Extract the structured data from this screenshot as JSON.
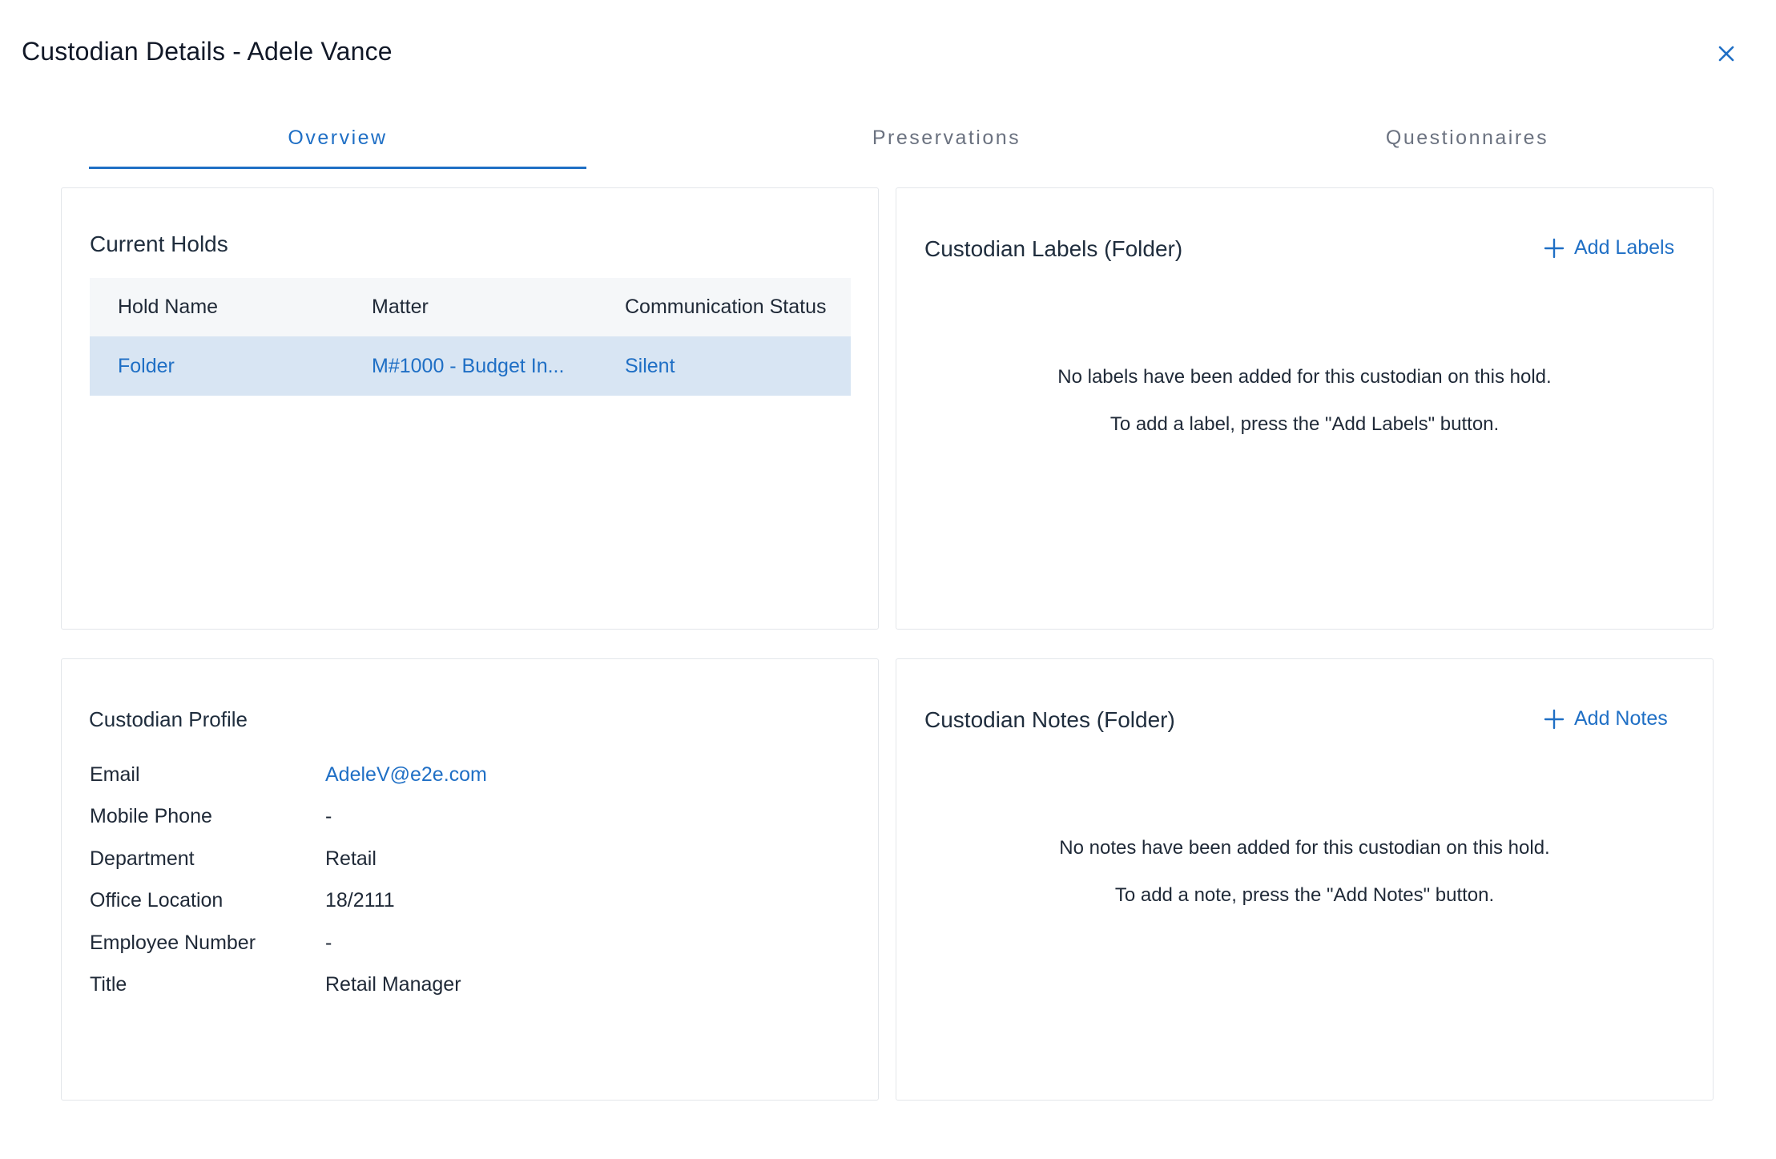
{
  "dialog": {
    "title": "Custodian Details - Adele Vance",
    "close_icon": "close-icon"
  },
  "tabs": [
    {
      "label": "Overview",
      "active": true
    },
    {
      "label": "Preservations",
      "active": false
    },
    {
      "label": "Questionnaires",
      "active": false
    }
  ],
  "current_holds": {
    "title": "Current Holds",
    "columns": [
      "Hold Name",
      "Matter",
      "Communication Status"
    ],
    "rows": [
      {
        "hold_name": "Folder",
        "matter": "M#1000 - Budget In...",
        "status": "Silent"
      }
    ]
  },
  "labels": {
    "title": "Custodian Labels (Folder)",
    "add_label": "Add Labels",
    "add_icon": "plus-icon",
    "empty_line1": "No labels have been added for this custodian on this hold.",
    "empty_line2": "To add a label, press the \"Add Labels\" button."
  },
  "profile": {
    "title": "Custodian Profile",
    "fields": [
      {
        "label": "Email",
        "value": "AdeleV@e2e.com"
      },
      {
        "label": "Mobile Phone",
        "value": "-"
      },
      {
        "label": "Department",
        "value": "Retail"
      },
      {
        "label": "Office Location",
        "value": "18/2111"
      },
      {
        "label": "Employee Number",
        "value": "-"
      },
      {
        "label": "Title",
        "value": "Retail Manager"
      }
    ]
  },
  "notes": {
    "title": "Custodian Notes (Folder)",
    "add_label": "Add Notes",
    "add_icon": "plus-icon",
    "empty_line1": "No notes have been added for this custodian on this hold.",
    "empty_line2": "To add a note, press the \"Add Notes\" button."
  },
  "colors": {
    "accent": "#1f6fc5",
    "selected_row": "#d8e5f3",
    "header_row": "#f5f7f9",
    "border": "#e3e6ea"
  }
}
